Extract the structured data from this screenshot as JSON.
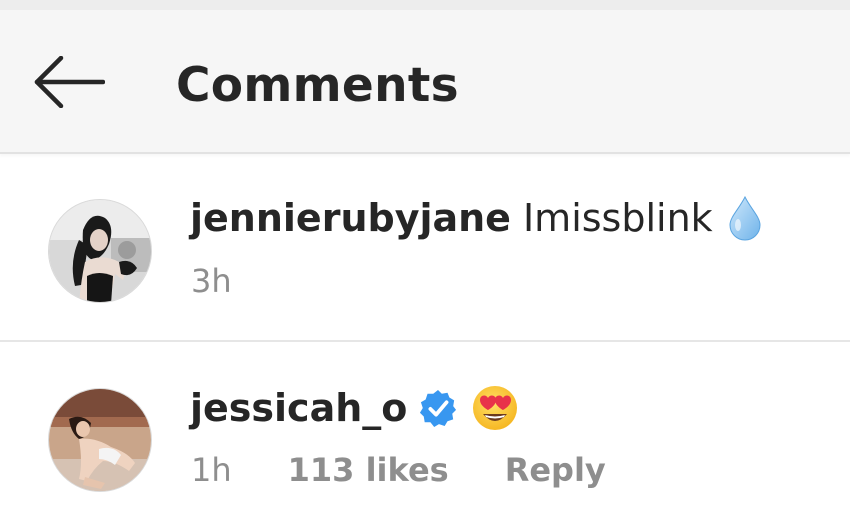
{
  "header": {
    "title": "Comments",
    "back_icon": "back-arrow-icon"
  },
  "comments": [
    {
      "username": "jennierubyjane",
      "text": "Imissblink",
      "emoji_icon": "droplet-icon",
      "time": "3h",
      "avatar": "profile-photo"
    },
    {
      "username": "jessicah_o",
      "verified": true,
      "verified_icon": "verified-badge-icon",
      "emoji_icon": "heart-eyes-emoji-icon",
      "time": "1h",
      "likes": "113 likes",
      "reply_label": "Reply",
      "avatar": "profile-photo"
    }
  ],
  "colors": {
    "header_bg": "#f6f6f6",
    "text": "#262626",
    "meta": "#8e8e8e",
    "verified": "#3897f0",
    "droplet": "#a9d4f5"
  }
}
